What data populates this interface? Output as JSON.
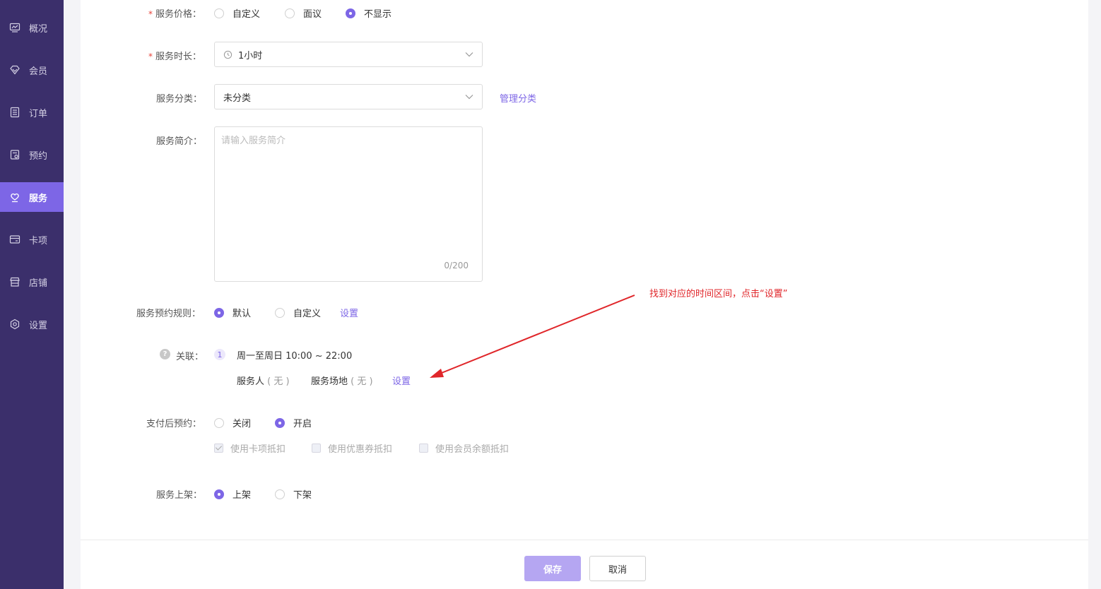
{
  "sidebar": {
    "items": [
      {
        "label": "概况",
        "icon": "monitor-icon"
      },
      {
        "label": "会员",
        "icon": "diamond-icon"
      },
      {
        "label": "订单",
        "icon": "list-icon"
      },
      {
        "label": "预约",
        "icon": "calendar-icon"
      },
      {
        "label": "服务",
        "icon": "heart-hand-icon",
        "active": true
      },
      {
        "label": "卡项",
        "icon": "card-icon"
      },
      {
        "label": "店铺",
        "icon": "store-icon"
      },
      {
        "label": "设置",
        "icon": "gear-icon"
      }
    ]
  },
  "form": {
    "price": {
      "label": "服务价格：",
      "options": [
        "自定义",
        "面议",
        "不显示"
      ],
      "selected": "不显示"
    },
    "duration": {
      "label": "服务时长：",
      "value": "1小时"
    },
    "category": {
      "label": "服务分类：",
      "value": "未分类",
      "manage_link": "管理分类"
    },
    "intro": {
      "label": "服务简介：",
      "placeholder": "请输入服务简介",
      "count": "0/200"
    },
    "booking_rule": {
      "label": "服务预约规则：",
      "options": [
        "默认",
        "自定义"
      ],
      "selected": "默认",
      "set_link": "设置"
    },
    "relation": {
      "label": "关联：",
      "help": "?",
      "index": "1",
      "schedule": "周一至周日 10:00 ~ 22:00",
      "staff_label": "服务人",
      "staff_value": "( 无 )",
      "venue_label": "服务场地",
      "venue_value": "( 无 )",
      "set_link": "设置"
    },
    "pay_booking": {
      "label": "支付后预约：",
      "options": [
        "关闭",
        "开启"
      ],
      "selected": "开启",
      "checkboxes": [
        {
          "label": "使用卡项抵扣",
          "checked": true
        },
        {
          "label": "使用优惠券抵扣",
          "checked": false
        },
        {
          "label": "使用会员余额抵扣",
          "checked": false
        }
      ]
    },
    "listing": {
      "label": "服务上架：",
      "options": [
        "上架",
        "下架"
      ],
      "selected": "上架"
    }
  },
  "footer": {
    "save": "保存",
    "cancel": "取消"
  },
  "annotation": {
    "text": "找到对应的时间区间，点击“设置”",
    "color": "#e0262a"
  },
  "colors": {
    "accent": "#7d66e6",
    "sidebar": "#3b2f6b"
  }
}
